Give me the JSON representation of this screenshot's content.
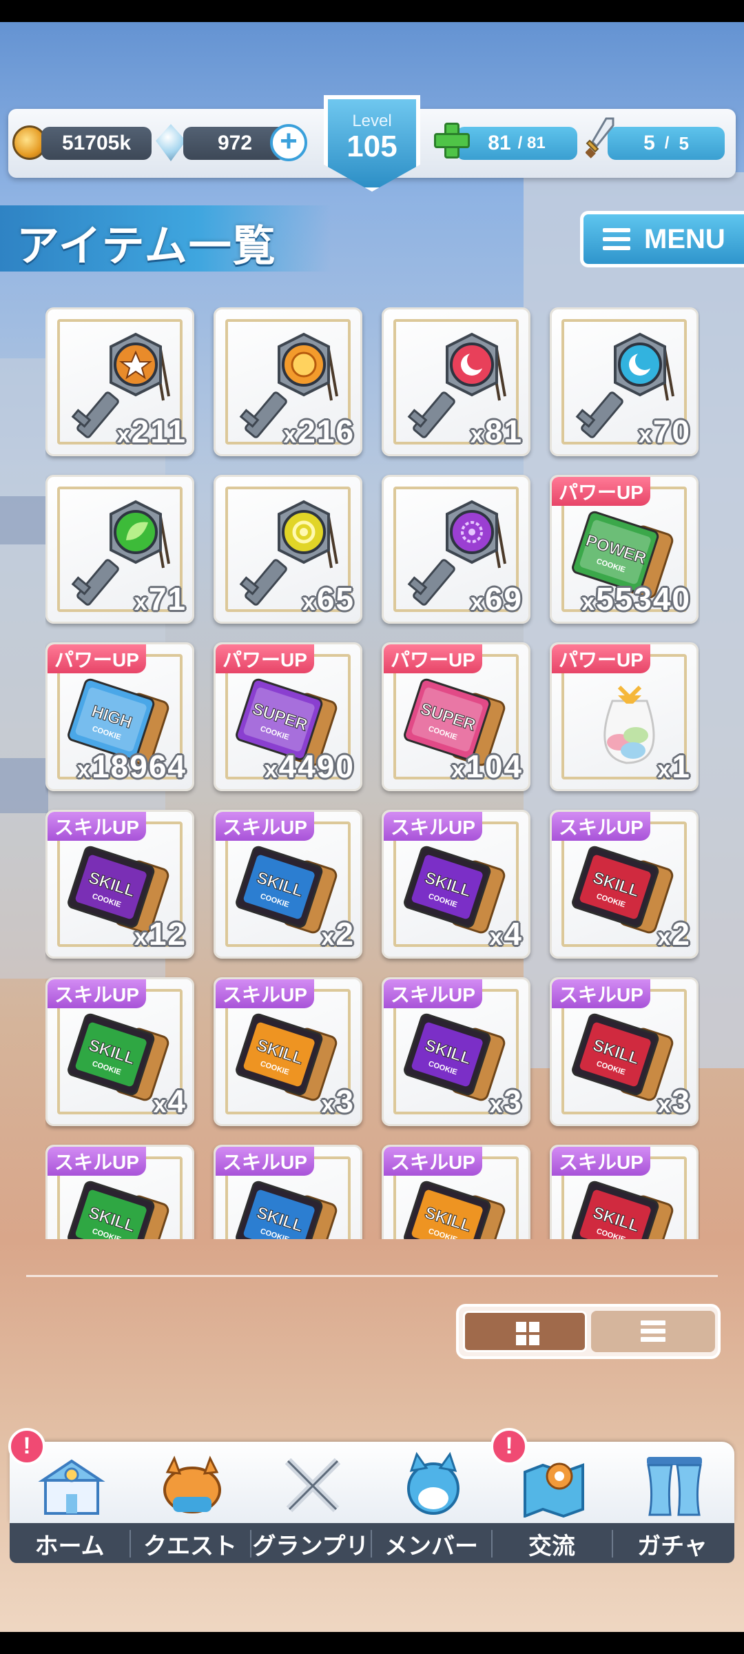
{
  "status": {
    "coins": "51705k",
    "gems": "972",
    "level_label": "Level",
    "level": "105",
    "stamina": "81",
    "stamina_max": "/ 81",
    "battle": "5",
    "battle_sep": "/",
    "battle_max": "5"
  },
  "title": "アイテム一覧",
  "menu_label": "MENU",
  "items": [
    {
      "count": "211",
      "tag": "",
      "icon": "key-star-icon",
      "color": "#e98b2a"
    },
    {
      "count": "216",
      "tag": "",
      "icon": "key-orb-icon",
      "color": "#f39b2c"
    },
    {
      "count": "81",
      "tag": "",
      "icon": "key-moon-icon",
      "color": "#e8405a"
    },
    {
      "count": "70",
      "tag": "",
      "icon": "key-moon-icon",
      "color": "#32b3df"
    },
    {
      "count": "71",
      "tag": "",
      "icon": "key-leaf-icon",
      "color": "#3dbb39"
    },
    {
      "count": "65",
      "tag": "",
      "icon": "key-sun-icon",
      "color": "#e1d527"
    },
    {
      "count": "69",
      "tag": "",
      "icon": "key-flower-icon",
      "color": "#9b3fd2"
    },
    {
      "count": "55340",
      "tag": "パワーUP",
      "tag_type": "power",
      "icon": "power-cookie-icon",
      "color": "#3ba84a"
    },
    {
      "count": "18964",
      "tag": "パワーUP",
      "tag_type": "power",
      "icon": "high-cookie-icon",
      "color": "#4aa7e8"
    },
    {
      "count": "4490",
      "tag": "パワーUP",
      "tag_type": "power",
      "icon": "super-cookie-icon",
      "color": "#8a3fd0"
    },
    {
      "count": "104",
      "tag": "パワーUP",
      "tag_type": "power",
      "icon": "super-cookie-icon",
      "color": "#e24a87"
    },
    {
      "count": "1",
      "tag": "パワーUP",
      "tag_type": "power",
      "icon": "macaron-bag-icon",
      "color": "#f2b9c1"
    },
    {
      "count": "12",
      "tag": "スキルUP",
      "tag_type": "skill",
      "icon": "skill-cookie-icon",
      "color": "#7a2fb5"
    },
    {
      "count": "2",
      "tag": "スキルUP",
      "tag_type": "skill",
      "icon": "skill-cookie-icon",
      "color": "#2c7ed1"
    },
    {
      "count": "4",
      "tag": "スキルUP",
      "tag_type": "skill",
      "icon": "skill-cookie-icon",
      "color": "#7b2fc7"
    },
    {
      "count": "2",
      "tag": "スキルUP",
      "tag_type": "skill",
      "icon": "skill-cookie-icon",
      "color": "#d02a3f"
    },
    {
      "count": "4",
      "tag": "スキルUP",
      "tag_type": "skill",
      "icon": "skill-cookie-icon",
      "color": "#2fa743"
    },
    {
      "count": "3",
      "tag": "スキルUP",
      "tag_type": "skill",
      "icon": "skill-cookie-icon",
      "color": "#ee9422"
    },
    {
      "count": "3",
      "tag": "スキルUP",
      "tag_type": "skill",
      "icon": "skill-cookie-icon",
      "color": "#7b2fc7"
    },
    {
      "count": "3",
      "tag": "スキルUP",
      "tag_type": "skill",
      "icon": "skill-cookie-icon",
      "color": "#d02a3f"
    },
    {
      "count": "",
      "tag": "スキルUP",
      "tag_type": "skill",
      "icon": "skill-cookie-icon",
      "color": "#2fa743"
    },
    {
      "count": "",
      "tag": "スキルUP",
      "tag_type": "skill",
      "icon": "skill-cookie-icon",
      "color": "#2c7ed1"
    },
    {
      "count": "",
      "tag": "スキルUP",
      "tag_type": "skill",
      "icon": "skill-cookie-icon",
      "color": "#ee9422"
    },
    {
      "count": "",
      "tag": "スキルUP",
      "tag_type": "skill",
      "icon": "skill-cookie-icon",
      "color": "#d02a3f"
    }
  ],
  "nav": [
    {
      "label": "ホーム",
      "icon": "school-icon",
      "alert": "!"
    },
    {
      "label": "クエスト",
      "icon": "monster-icon",
      "alert": ""
    },
    {
      "label": "グランプリ",
      "icon": "crossed-swords-icon",
      "alert": ""
    },
    {
      "label": "メンバー",
      "icon": "character-icon",
      "alert": ""
    },
    {
      "label": "交流",
      "icon": "map-icon",
      "alert": "!"
    },
    {
      "label": "ガチャ",
      "icon": "curtain-icon",
      "alert": ""
    }
  ]
}
